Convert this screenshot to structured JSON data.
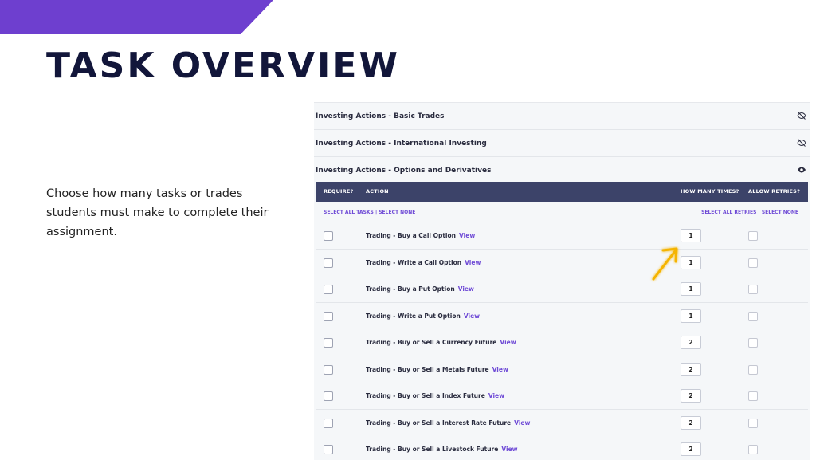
{
  "slide": {
    "title": "TASK OVERVIEW",
    "description": "Choose how many tasks or trades students must make to complete their assignment.",
    "accent_color": "#6e3fcf"
  },
  "sections": [
    {
      "label": "Investing Actions - Basic Trades",
      "icon": "eye-slash-icon"
    },
    {
      "label": "Investing Actions - International Investing",
      "icon": "eye-slash-icon"
    },
    {
      "label": "Investing Actions - Options and Derivatives",
      "icon": "eye-icon"
    }
  ],
  "table": {
    "headers": {
      "require": "REQUIRE?",
      "action": "ACTION",
      "times": "HOW MANY TIMES?",
      "retries": "ALLOW RETRIES?"
    },
    "select_left": "SELECT ALL TASKS | SELECT NONE",
    "select_right": "SELECT ALL RETRIES | SELECT NONE",
    "view_label": "View",
    "rows": [
      {
        "action": "Trading - Buy a Call Option",
        "times": "1"
      },
      {
        "action": "Trading - Write a Call Option",
        "times": "1"
      },
      {
        "action": "Trading - Buy a Put Option",
        "times": "1"
      },
      {
        "action": "Trading - Write a Put Option",
        "times": "1"
      },
      {
        "action": "Trading - Buy or Sell a Currency Future",
        "times": "2"
      },
      {
        "action": "Trading - Buy or Sell a Metals Future",
        "times": "2"
      },
      {
        "action": "Trading - Buy or Sell a Index Future",
        "times": "2"
      },
      {
        "action": "Trading - Buy or Sell a Interest Rate Future",
        "times": "2"
      },
      {
        "action": "Trading - Buy or Sell a Livestock Future",
        "times": "2"
      }
    ]
  }
}
